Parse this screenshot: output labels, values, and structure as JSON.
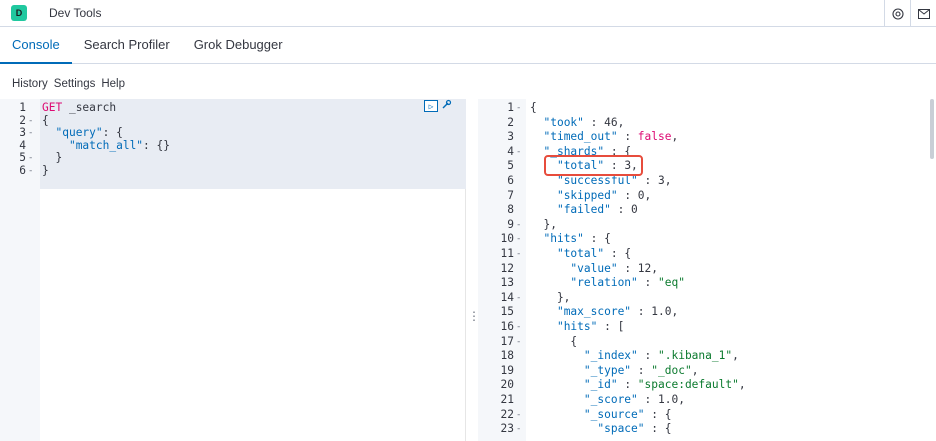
{
  "header": {
    "avatar_letter": "D",
    "title": "Dev Tools",
    "help_icon": "lifebuoy-icon",
    "mail_icon": "mail-icon"
  },
  "tabs": [
    {
      "label": "Console",
      "active": true
    },
    {
      "label": "Search Profiler",
      "active": false
    },
    {
      "label": "Grok Debugger",
      "active": false
    }
  ],
  "menu": {
    "history": "History",
    "settings": "Settings",
    "help": "Help"
  },
  "colors": {
    "accent": "#006bb8",
    "annotation": "#e74c3c",
    "avatar": "#20c89f"
  },
  "request": {
    "lines": [
      {
        "n": "1",
        "fold": "",
        "text": "GET _search"
      },
      {
        "n": "2",
        "fold": "▾",
        "text": "{"
      },
      {
        "n": "3",
        "fold": "▾",
        "text": "  \"query\": {"
      },
      {
        "n": "4",
        "fold": "",
        "text": "    \"match_all\": {}"
      },
      {
        "n": "5",
        "fold": "▴",
        "text": "  }"
      },
      {
        "n": "6",
        "fold": "▴",
        "text": "}"
      }
    ]
  },
  "response": {
    "lines": [
      {
        "n": "1",
        "fold": "▾",
        "text": "{"
      },
      {
        "n": "2",
        "fold": "",
        "text": "  \"took\" : 46,"
      },
      {
        "n": "3",
        "fold": "",
        "text": "  \"timed_out\" : false,"
      },
      {
        "n": "4",
        "fold": "▾",
        "text": "  \"_shards\" : {"
      },
      {
        "n": "5",
        "fold": "",
        "text": "    \"total\" : 3,"
      },
      {
        "n": "6",
        "fold": "",
        "text": "    \"successful\" : 3,"
      },
      {
        "n": "7",
        "fold": "",
        "text": "    \"skipped\" : 0,"
      },
      {
        "n": "8",
        "fold": "",
        "text": "    \"failed\" : 0"
      },
      {
        "n": "9",
        "fold": "▴",
        "text": "  },"
      },
      {
        "n": "10",
        "fold": "▾",
        "text": "  \"hits\" : {"
      },
      {
        "n": "11",
        "fold": "▾",
        "text": "    \"total\" : {"
      },
      {
        "n": "12",
        "fold": "",
        "text": "      \"value\" : 12,"
      },
      {
        "n": "13",
        "fold": "",
        "text": "      \"relation\" : \"eq\""
      },
      {
        "n": "14",
        "fold": "▴",
        "text": "    },"
      },
      {
        "n": "15",
        "fold": "",
        "text": "    \"max_score\" : 1.0,"
      },
      {
        "n": "16",
        "fold": "▾",
        "text": "    \"hits\" : ["
      },
      {
        "n": "17",
        "fold": "▾",
        "text": "      {"
      },
      {
        "n": "18",
        "fold": "",
        "text": "        \"_index\" : \".kibana_1\","
      },
      {
        "n": "19",
        "fold": "",
        "text": "        \"_type\" : \"_doc\","
      },
      {
        "n": "20",
        "fold": "",
        "text": "        \"_id\" : \"space:default\","
      },
      {
        "n": "21",
        "fold": "",
        "text": "        \"_score\" : 1.0,"
      },
      {
        "n": "22",
        "fold": "▾",
        "text": "        \"_source\" : {"
      },
      {
        "n": "23",
        "fold": "▾",
        "text": "          \"space\" : {"
      }
    ]
  }
}
